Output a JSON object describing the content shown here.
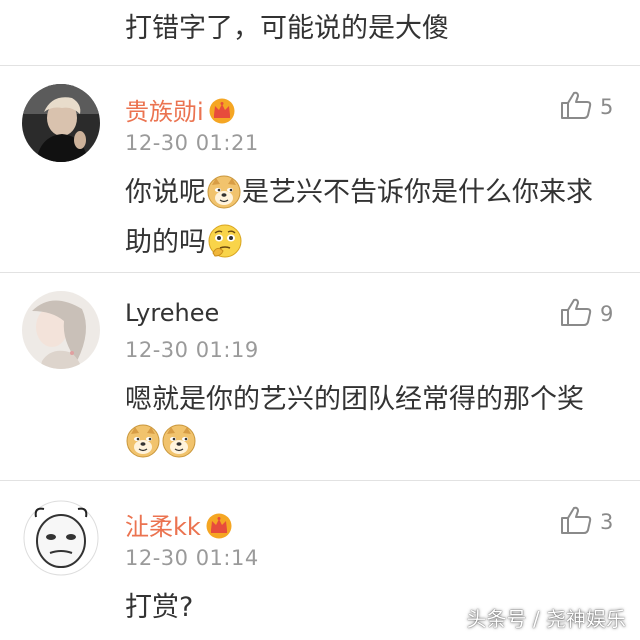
{
  "previous_comment": {
    "text": "打错字了，可能说的是大傻"
  },
  "comments": [
    {
      "username": "贵族勋i",
      "vip": true,
      "timestamp": "12-30 01:21",
      "likes": "5",
      "text_parts": [
        "你说呢",
        "是艺兴不告诉你是什么你来求助的吗",
        ""
      ]
    },
    {
      "username": "Lyrehee",
      "vip": false,
      "timestamp": "12-30 01:19",
      "likes": "9",
      "text_parts": [
        "嗯就是你的艺兴的团队经常得的那个奖"
      ]
    },
    {
      "username": "沚柔kk",
      "vip": true,
      "timestamp": "12-30 01:14",
      "likes": "3",
      "text_parts": [
        "打赏?"
      ]
    }
  ],
  "watermark": "头条号 / 尧神娱乐",
  "icons": {
    "like": "thumbs-up-icon",
    "vip": "crown-icon",
    "doge": "doge-emoji",
    "think": "thinking-emoji"
  },
  "colors": {
    "vip_name": "#eb7350",
    "text": "#333333",
    "meta": "#9a9a9a",
    "divider": "#e2e2e2"
  }
}
